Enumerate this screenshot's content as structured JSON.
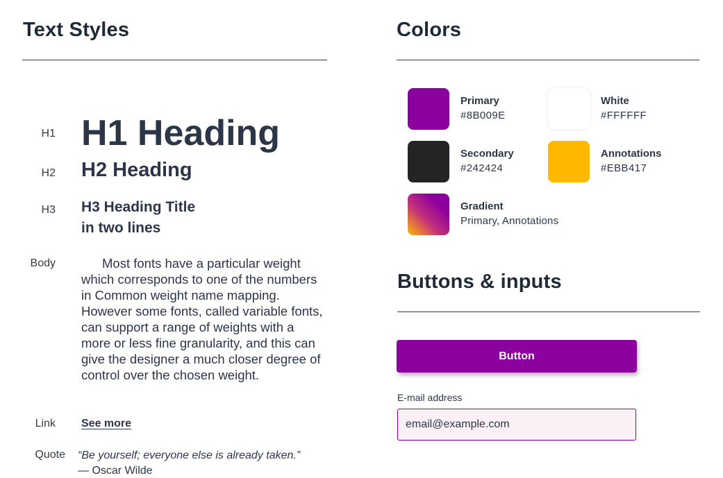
{
  "text_styles": {
    "title": "Text Styles",
    "h1": {
      "label": "H1",
      "sample": "H1 Heading"
    },
    "h2": {
      "label": "H2",
      "sample": "H2 Heading"
    },
    "h3": {
      "label": "H3",
      "sample": "H3 Heading Title\nin two lines"
    },
    "body": {
      "label": "Body",
      "sample": "Most fonts have a particular weight which corresponds to one of the numbers in Common weight name mapping. However some fonts, called variable fonts, can support a range of weights with a more or less fine granularity, and this can give the designer a much closer degree of control over the chosen weight."
    },
    "link": {
      "label": "Link",
      "sample": "See more"
    },
    "quote": {
      "label": "Quote",
      "text": "“Be yourself; everyone else is already taken.”",
      "author": "— Oscar Wilde"
    }
  },
  "colors": {
    "title": "Colors",
    "items": [
      {
        "name": "Primary",
        "value": "#8B009E",
        "hex": "#8B009E"
      },
      {
        "name": "White",
        "value": "#FFFFFF",
        "hex": "#FFFFFF"
      },
      {
        "name": "Secondary",
        "value": "#242424",
        "hex": "#242424"
      },
      {
        "name": "Annotations",
        "value": "#EBB417",
        "hex": "#FFB800"
      },
      {
        "name": "Gradient",
        "value": "Primary, Annotations"
      }
    ]
  },
  "buttons_inputs": {
    "title": "Buttons & inputs",
    "button_label": "Button",
    "email_label": "E-mail address",
    "email_placeholder": "email@example.com"
  }
}
